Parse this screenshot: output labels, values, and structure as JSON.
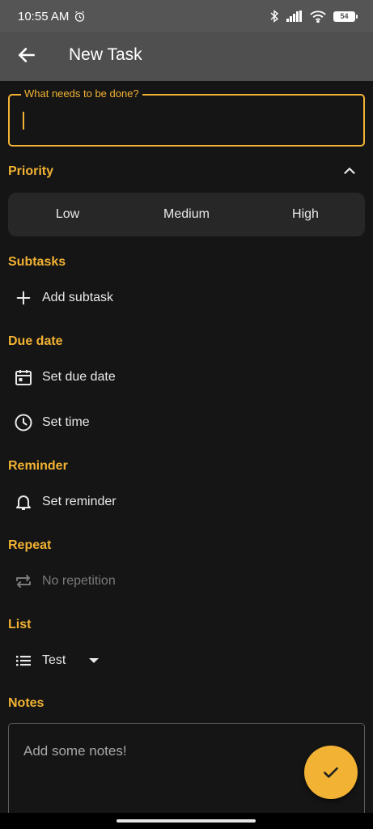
{
  "status_bar": {
    "time": "10:55 AM",
    "battery": "54"
  },
  "app_bar": {
    "title": "New Task"
  },
  "task_input": {
    "label": "What needs to be done?",
    "value": ""
  },
  "priority": {
    "title": "Priority",
    "options": [
      "Low",
      "Medium",
      "High"
    ]
  },
  "subtasks": {
    "title": "Subtasks",
    "add_label": "Add subtask"
  },
  "due_date": {
    "title": "Due date",
    "set_date_label": "Set due date",
    "set_time_label": "Set time"
  },
  "reminder": {
    "title": "Reminder",
    "set_label": "Set reminder"
  },
  "repeat": {
    "title": "Repeat",
    "value": "No repetition"
  },
  "list": {
    "title": "List",
    "selected": "Test"
  },
  "notes": {
    "title": "Notes",
    "placeholder": "Add some notes!"
  },
  "colors": {
    "accent": "#f2b233",
    "background": "#151515",
    "app_bar": "#4f4f4f",
    "status_bar": "#555555"
  }
}
